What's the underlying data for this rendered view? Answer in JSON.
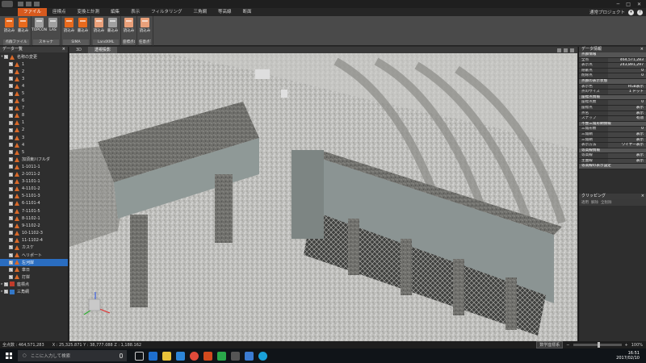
{
  "ribbon_tabs": [
    "ファイル",
    "座標点",
    "変換と計測",
    "編集",
    "表示",
    "フィルタリング",
    "三角網",
    "等高線",
    "断面"
  ],
  "ribbon_tab_active": 0,
  "ribbon_right": {
    "label": "通常プロジェクト",
    "help": "?"
  },
  "ribbon_groups": [
    {
      "label": "点群ファイル",
      "buttons": [
        {
          "label": "読込み",
          "style": ""
        },
        {
          "label": "書込み",
          "style": ""
        }
      ]
    },
    {
      "label": "スキャナ",
      "buttons": [
        {
          "label": "TOPCON",
          "style": "grey"
        },
        {
          "label": "LAS",
          "style": "grey"
        }
      ]
    },
    {
      "label": "SIMA",
      "buttons": [
        {
          "label": "読込み",
          "style": ""
        },
        {
          "label": "書込み",
          "style": ""
        }
      ]
    },
    {
      "label": "LandXML",
      "buttons": [
        {
          "label": "読込み",
          "style": "light"
        },
        {
          "label": "書込み",
          "style": "grey"
        }
      ]
    },
    {
      "label": "座標点の推量",
      "buttons": [
        {
          "label": "読込み",
          "style": "light"
        }
      ]
    },
    {
      "label": "任意点マーク",
      "buttons": [
        {
          "label": "読込み",
          "style": "light"
        }
      ]
    }
  ],
  "left_panel": {
    "title": "データ一覧",
    "close": "×",
    "items": [
      {
        "label": "名称の変更",
        "kind": "root"
      },
      {
        "label": "1",
        "kind": "pts"
      },
      {
        "label": "2",
        "kind": "pts"
      },
      {
        "label": "3",
        "kind": "pts"
      },
      {
        "label": "4",
        "kind": "pts"
      },
      {
        "label": "5",
        "kind": "pts"
      },
      {
        "label": "6",
        "kind": "pts"
      },
      {
        "label": "7",
        "kind": "pts"
      },
      {
        "label": "8",
        "kind": "pts"
      },
      {
        "label": "1",
        "kind": "pts"
      },
      {
        "label": "2",
        "kind": "pts"
      },
      {
        "label": "3",
        "kind": "pts"
      },
      {
        "label": "4",
        "kind": "pts"
      },
      {
        "label": "5",
        "kind": "pts"
      },
      {
        "label": "加須東川フルダ",
        "kind": "pts"
      },
      {
        "label": "1-1011-1",
        "kind": "pts"
      },
      {
        "label": "2-1011-2",
        "kind": "pts"
      },
      {
        "label": "3-1101-1",
        "kind": "pts"
      },
      {
        "label": "4-1101-2",
        "kind": "pts"
      },
      {
        "label": "5-1101-3",
        "kind": "pts"
      },
      {
        "label": "6-1101-4",
        "kind": "pts"
      },
      {
        "label": "7-1101-5",
        "kind": "pts"
      },
      {
        "label": "8-1102-1",
        "kind": "pts"
      },
      {
        "label": "9-1102-2",
        "kind": "pts"
      },
      {
        "label": "10-1102-3",
        "kind": "pts"
      },
      {
        "label": "11-1102-4",
        "kind": "pts"
      },
      {
        "label": "カスケ",
        "kind": "pts"
      },
      {
        "label": "ヘリポート",
        "kind": "pts"
      },
      {
        "label": "左河岸",
        "kind": "pts",
        "selected": true
      },
      {
        "label": "章日",
        "kind": "pts"
      },
      {
        "label": "打岸",
        "kind": "pts"
      },
      {
        "label": "座標点",
        "kind": "group-red"
      },
      {
        "label": "三角網",
        "kind": "group-blue"
      }
    ]
  },
  "viewport_tabs": [
    "3D",
    "透視投影"
  ],
  "viewport_tab_active": 1,
  "right_panel": {
    "title": "データ情報",
    "rows": [
      {
        "k": "点群情報",
        "section": true
      },
      {
        "k": "全点",
        "v": "464,571,283"
      },
      {
        "k": "表示点",
        "v": "243,891,297"
      },
      {
        "k": "隠蔽点",
        "v": "0"
      },
      {
        "k": "削除点",
        "v": "0"
      },
      {
        "k": "点群の表示状態",
        "section": true
      },
      {
        "k": "表示色",
        "v": "RGB表示"
      },
      {
        "k": "点のサイズ",
        "v": "1 ドット"
      },
      {
        "k": "座標点情報",
        "section": true
      },
      {
        "k": "座標点数",
        "v": "0"
      },
      {
        "k": "座標点",
        "v": "表示"
      },
      {
        "k": "点名",
        "v": "表示"
      },
      {
        "k": "スナップ",
        "v": "有効"
      },
      {
        "k": "不整三角形網情報",
        "section": true
      },
      {
        "k": "三角形数",
        "v": "0"
      },
      {
        "k": "三角網",
        "v": "表示"
      },
      {
        "k": "三角網",
        "v": "表示"
      },
      {
        "k": "表示方法",
        "v": "ワイヤー表示"
      },
      {
        "k": "等高線情報",
        "section": true
      },
      {
        "k": "等高線",
        "v": "表示"
      },
      {
        "k": "主曲線",
        "v": "表示"
      },
      {
        "k": "等高線の表示設定",
        "section": true
      }
    ]
  },
  "clipping": {
    "title": "クリッピング",
    "tools": [
      "適用",
      "解除",
      "全削除"
    ]
  },
  "status": {
    "total": "全点数 : 464,571,283",
    "coords": "X : 25,325.871  Y : 38,777.088  Z : 1,188.162",
    "mode": "数学座標系",
    "zoom": "100%"
  },
  "taskbar": {
    "search_placeholder": "ここに入力して検索",
    "search_hint": "質問やキーワードを入力",
    "time": "16:51",
    "date": "2017/02/10"
  }
}
